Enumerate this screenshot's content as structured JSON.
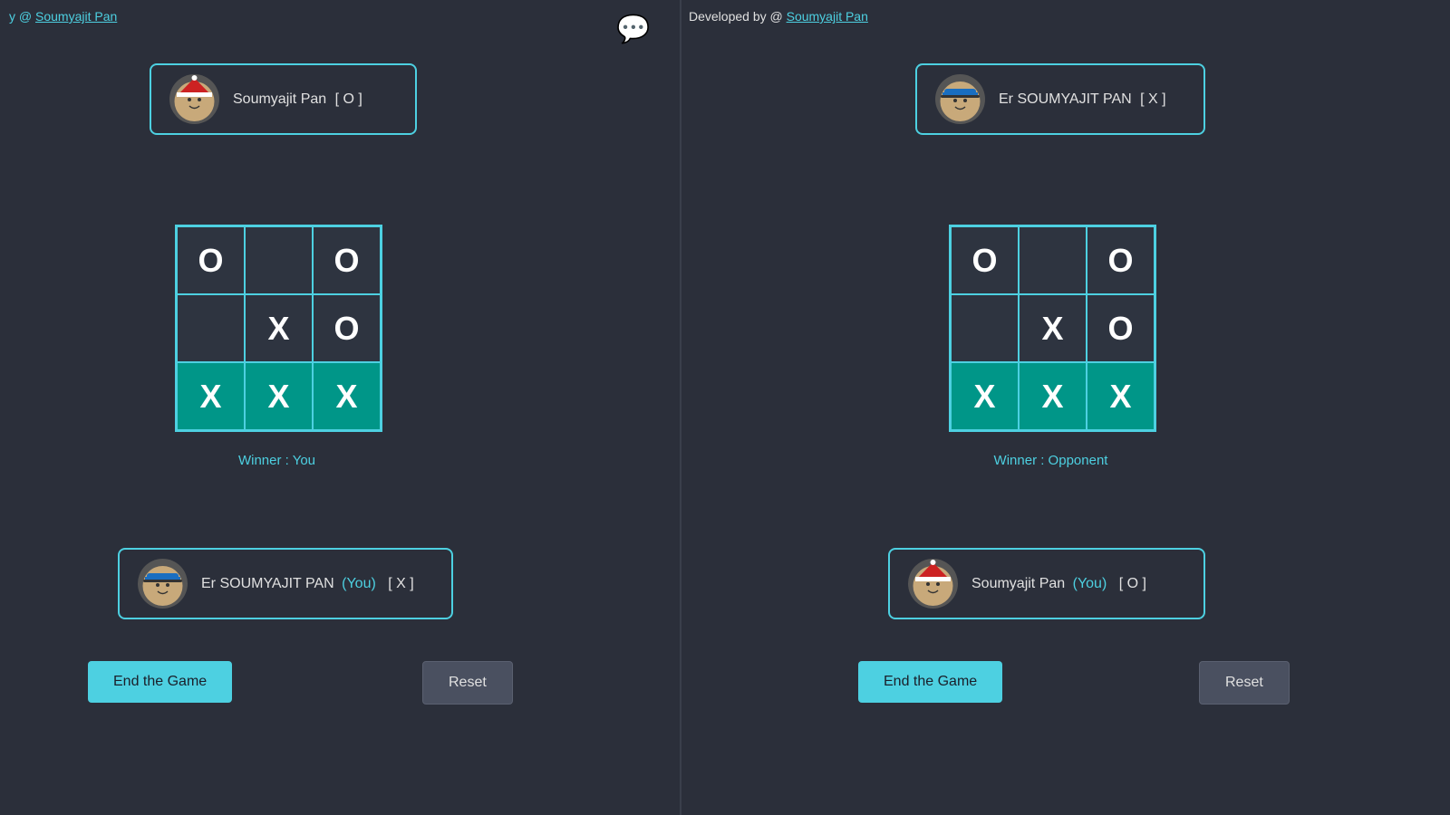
{
  "header": {
    "left_prefix": "y @",
    "left_link": "Soumyajit Pan",
    "right_text": "Developed by @",
    "right_link": "Soumyajit Pan"
  },
  "panels": {
    "left": {
      "top_player": {
        "name": "Soumyajit Pan",
        "symbol": "[ O ]",
        "avatar_type": "santa"
      },
      "board": [
        [
          "O",
          "",
          "O"
        ],
        [
          "",
          "X",
          "O"
        ],
        [
          "X",
          "X",
          "X"
        ]
      ],
      "winning_row": 2,
      "winner_text": "Winner : You",
      "bottom_player": {
        "name": "Er SOUMYAJIT PAN",
        "you_tag": "(You)",
        "symbol": "[ X ]",
        "avatar_type": "cap"
      },
      "btn_end": "End the Game",
      "btn_reset": "Reset"
    },
    "right": {
      "top_player": {
        "name": "Er SOUMYAJIT PAN",
        "symbol": "[ X ]",
        "avatar_type": "cap"
      },
      "board": [
        [
          "O",
          "",
          "O"
        ],
        [
          "",
          "X",
          "O"
        ],
        [
          "X",
          "X",
          "X"
        ]
      ],
      "winning_row": 2,
      "winner_text": "Winner : Opponent",
      "bottom_player": {
        "name": "Soumyajit Pan",
        "you_tag": "(You)",
        "symbol": "[ O ]",
        "avatar_type": "santa"
      },
      "btn_end": "End the Game",
      "btn_reset": "Reset"
    }
  }
}
